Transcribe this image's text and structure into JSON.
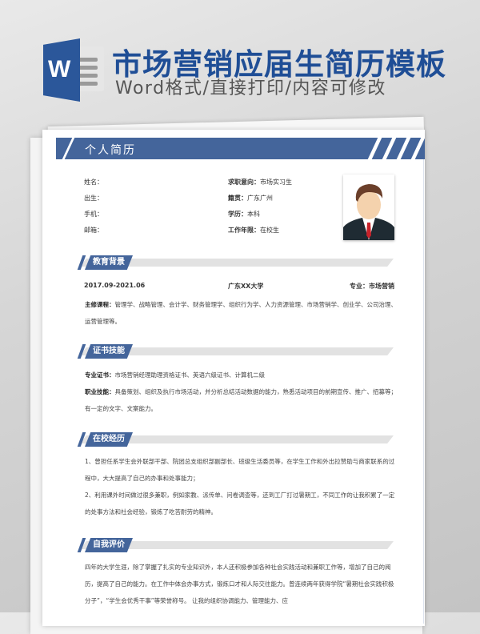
{
  "banner": {
    "logo_letter": "W",
    "title": "市场营销应届生简历模板",
    "subtitle": "Word格式/直接打印/内容可修改"
  },
  "resume": {
    "header": "个人简历",
    "basic": {
      "name_label": "姓名：",
      "birth_label": "出生：",
      "phone_label": "手机：",
      "email_label": "邮箱：",
      "intent_label": "求职意向：",
      "intent": "市场实习生",
      "origin_label": "籍贯：",
      "origin": "广东广州",
      "degree_label": "学历：",
      "degree": "本科",
      "years_label": "工作年限：",
      "years": "在校生"
    },
    "education": {
      "title": "教育背景",
      "period": "2017.09-2021.06",
      "school": "广东XX大学",
      "major_label": "专业：",
      "major": "市场营销",
      "courses_label": "主修课程：",
      "courses": "管理学、战略管理、会计学、财务管理学、组织行为学、人力资源管理、市场营销学、创业学、公司治理、运营管理等。"
    },
    "skills": {
      "title": "证书技能",
      "cert_label": "专业证书：",
      "cert": "市场营销经理助理资格证书、英语六级证书、计算机二级",
      "ability_label": "职业技能：",
      "ability": "具备策划、组织及执行市场活动，并分析总结活动数据的能力，熟悉活动项目的前期宣传、推广、招募等；有一定的文字、文案能力。"
    },
    "campus": {
      "title": "在校经历",
      "items": [
        "1、曾担任系学生会外联部干部、院团总支组织部副部长、班级生活委员等，在学生工作和外出拉赞助与商家联系的过程中，大大提高了自己的办事和处事能力；",
        "2、利用课外时间做过很多兼职，例如家教、派传单、问卷调查等，还到工厂打过暑期工，不同工作的让我积累了一定的处事方法和社会经验，锻炼了吃苦耐劳的精神。"
      ]
    },
    "self": {
      "title": "自我评价",
      "text": "四年的大学生涯，除了掌握了扎实的专业知识外，本人还积极参加各种社会实践活动和兼职工作等，增加了自己的阅历，提高了自己的能力。在工作中体会办事方式，锻炼口才和人际交往能力。曾连续两年获得学院“暑期社会实践积极分子”，“学生会优秀干事”等荣誉称号。 让我的组织协调能力、管理能力、应"
    }
  }
}
